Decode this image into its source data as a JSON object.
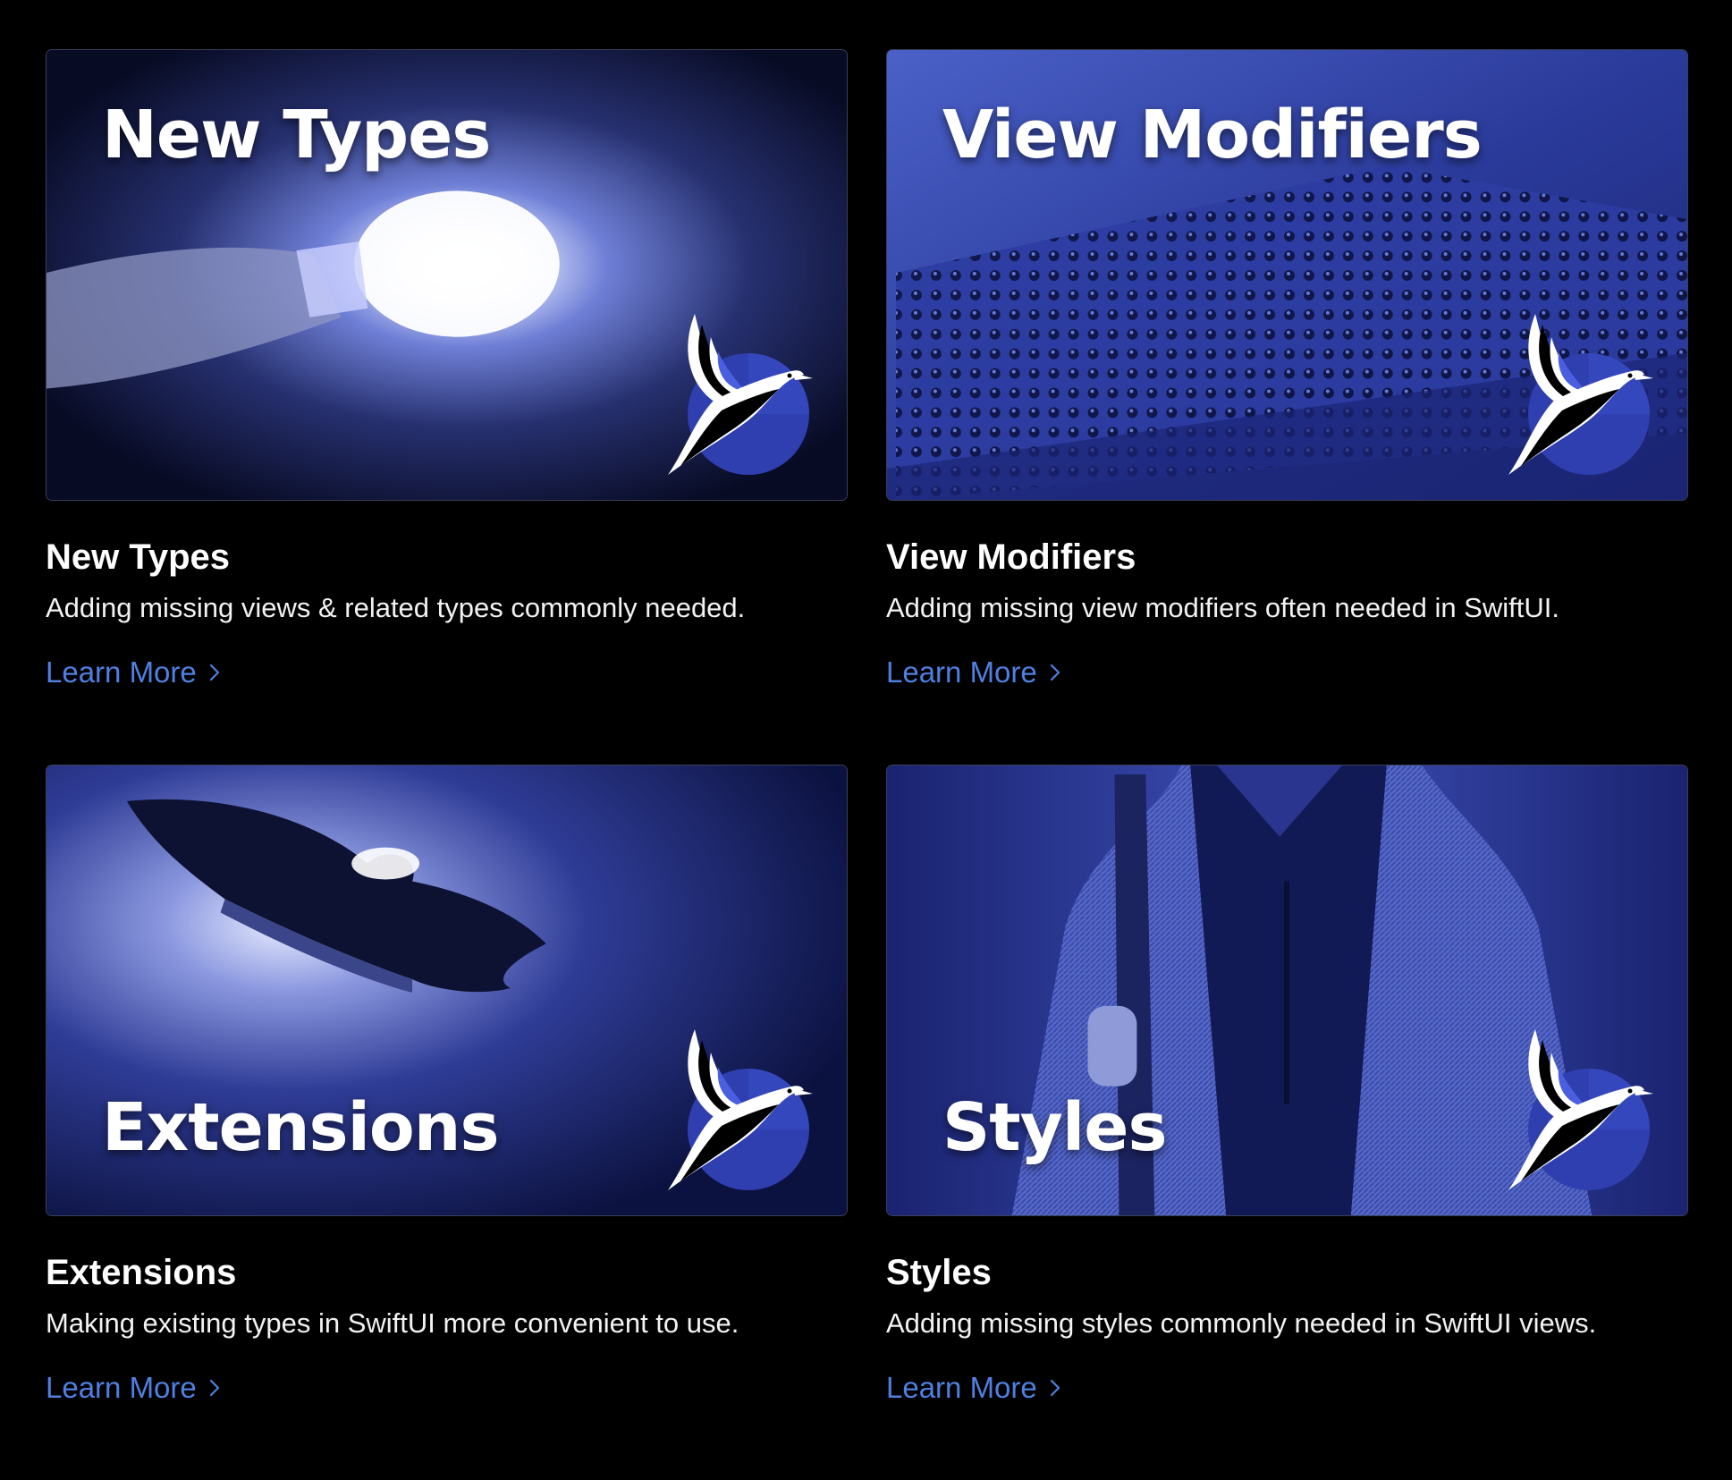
{
  "colors": {
    "background": "#000000",
    "link": "#4f80e1",
    "banner_tint": "#2b3a9e"
  },
  "cards": [
    {
      "banner_text": "New Types",
      "banner_position": "top",
      "image_subject": "hand holding glowing light bulb",
      "title": "New Types",
      "description": "Adding missing views & related types commonly needed.",
      "link_label": "Learn More",
      "link_icon": "chevron-right-icon",
      "badge_icon": "swift-bird-logo-icon"
    },
    {
      "banner_text": "View Modifiers",
      "banner_position": "top",
      "image_subject": "audio mixing console",
      "title": "View Modifiers",
      "description": "Adding missing view modifiers often needed in SwiftUI.",
      "link_label": "Learn More",
      "link_icon": "chevron-right-icon",
      "badge_icon": "swift-bird-logo-icon"
    },
    {
      "banner_text": "Extensions",
      "banner_position": "bottom",
      "image_subject": "puzzle piece with light",
      "title": "Extensions",
      "description": "Making existing types in SwiftUI more convenient to use.",
      "link_label": "Learn More",
      "link_icon": "chevron-right-icon",
      "badge_icon": "swift-bird-logo-icon"
    },
    {
      "banner_text": "Styles",
      "banner_position": "bottom",
      "image_subject": "man in tweed jacket with backpack",
      "title": "Styles",
      "description": "Adding missing styles commonly needed in SwiftUI views.",
      "link_label": "Learn More",
      "link_icon": "chevron-right-icon",
      "badge_icon": "swift-bird-logo-icon"
    }
  ]
}
